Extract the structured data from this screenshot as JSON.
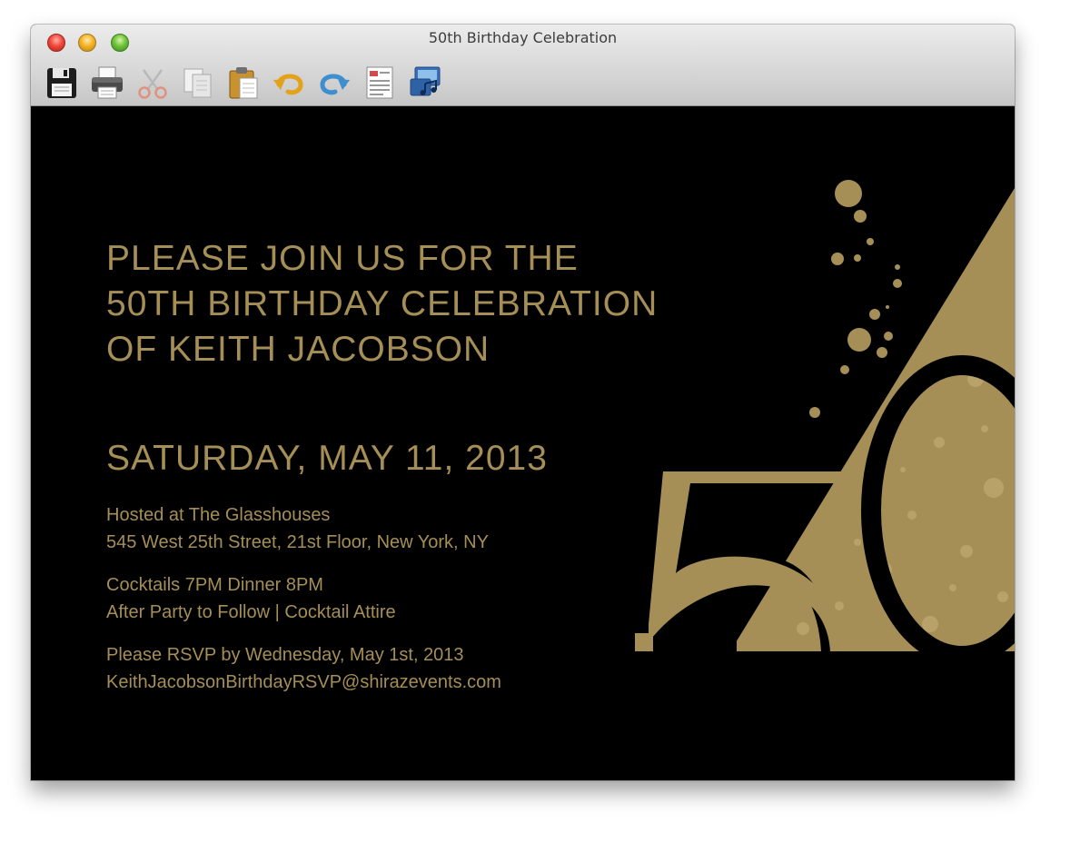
{
  "window": {
    "title": "50th Birthday Celebration"
  },
  "toolbar": {
    "buttons": [
      {
        "icon": "floppy-disk-icon",
        "label": "Save"
      },
      {
        "icon": "printer-icon",
        "label": "Print"
      },
      {
        "icon": "scissors-icon",
        "label": "Cut"
      },
      {
        "icon": "copy-icon",
        "label": "Copy"
      },
      {
        "icon": "clipboard-icon",
        "label": "Paste"
      },
      {
        "icon": "undo-icon",
        "label": "Undo"
      },
      {
        "icon": "redo-icon",
        "label": "Redo"
      },
      {
        "icon": "form-icon",
        "label": "Form"
      },
      {
        "icon": "media-icon",
        "label": "Media"
      }
    ]
  },
  "invitation": {
    "headline": [
      "PLEASE JOIN US FOR THE",
      "50TH BIRTHDAY CELEBRATION",
      "OF KEITH JACOBSON"
    ],
    "date": "SATURDAY, MAY 11, 2013",
    "venue": [
      "Hosted at The Glasshouses",
      "545 West 25th Street, 21st Floor, New York, NY"
    ],
    "schedule": [
      "Cocktails 7PM Dinner 8PM",
      "After Party to Follow  |  Cocktail Attire"
    ],
    "rsvp": [
      "Please RSVP by Wednesday, May 1st, 2013",
      "KeithJacobsonBirthdayRSVP@shirazevents.com"
    ],
    "big_number": "50"
  },
  "colors": {
    "gold": "#a58f56",
    "background": "#000000"
  }
}
